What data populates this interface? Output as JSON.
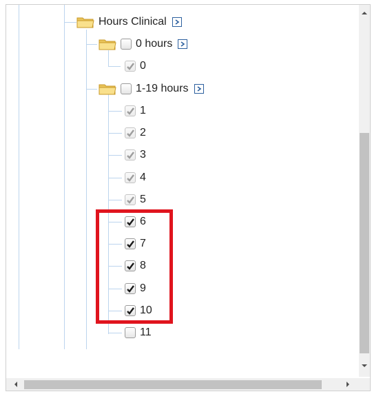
{
  "tree": {
    "group": {
      "label": "Hours Clinical",
      "icon": "folder-icon",
      "expand_icon": "chevron-right-icon"
    },
    "zero_hours": {
      "label": "0 hours",
      "children": [
        {
          "label": "0",
          "checked": true,
          "disabled": true
        }
      ]
    },
    "one_to_nineteen": {
      "label": "1-19 hours",
      "children": [
        {
          "label": "1",
          "checked": true,
          "disabled": true
        },
        {
          "label": "2",
          "checked": true,
          "disabled": true
        },
        {
          "label": "3",
          "checked": true,
          "disabled": true
        },
        {
          "label": "4",
          "checked": true,
          "disabled": true
        },
        {
          "label": "5",
          "checked": true,
          "disabled": true
        },
        {
          "label": "6",
          "checked": true,
          "disabled": false
        },
        {
          "label": "7",
          "checked": true,
          "disabled": false
        },
        {
          "label": "8",
          "checked": true,
          "disabled": false
        },
        {
          "label": "9",
          "checked": true,
          "disabled": false
        },
        {
          "label": "10",
          "checked": true,
          "disabled": false
        },
        {
          "label": "11",
          "checked": false,
          "disabled": false
        }
      ]
    }
  },
  "highlight_color": "#e0141e",
  "tree_line_color": "#bcd4ee"
}
